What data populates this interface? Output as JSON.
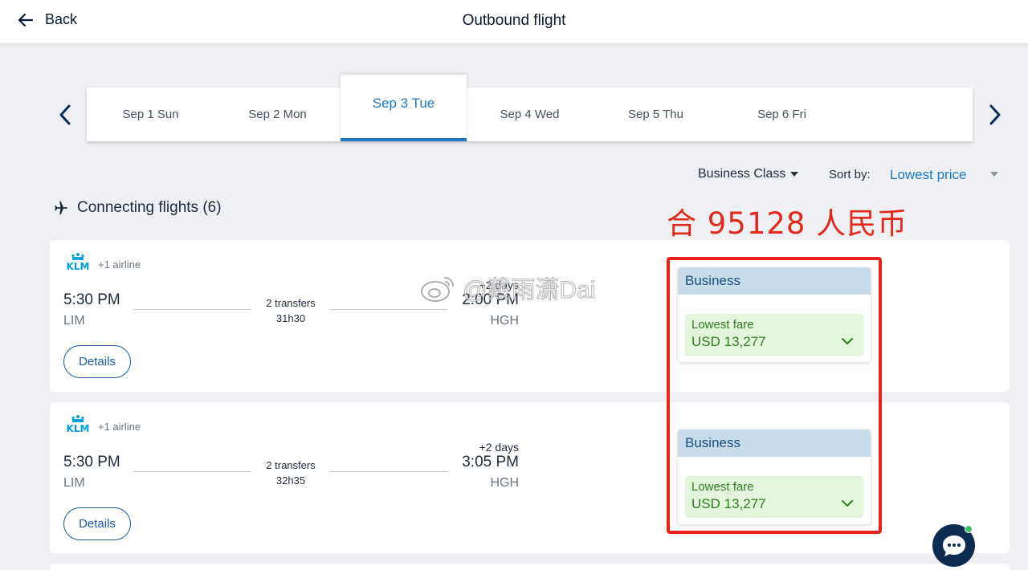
{
  "header": {
    "back_label": "Back",
    "title": "Outbound flight"
  },
  "dates": [
    {
      "label": "Sep 1 Sun",
      "active": false
    },
    {
      "label": "Sep 2 Mon",
      "active": false
    },
    {
      "label": "Sep 3 Tue",
      "active": true
    },
    {
      "label": "Sep 4 Wed",
      "active": false
    },
    {
      "label": "Sep 5 Thu",
      "active": false
    },
    {
      "label": "Sep 6 Fri",
      "active": false
    }
  ],
  "filters": {
    "cabin": "Business Class",
    "sort_label": "Sort by:",
    "sort_value": "Lowest price"
  },
  "section": {
    "title": "Connecting flights (6)"
  },
  "annotation": {
    "text": "合 95128 人民币"
  },
  "watermark": {
    "text": "@戴雨潇Dai"
  },
  "flights": [
    {
      "airline_logo": "KLM",
      "airline_extra": "+1 airline",
      "dep_time": "5:30 PM",
      "dep_code": "LIM",
      "transfers": "2 transfers",
      "duration": "31h30",
      "arr_days": "+2 days",
      "arr_time": "2:00 PM",
      "arr_code": "HGH",
      "details_label": "Details",
      "fare": {
        "cabin": "Business",
        "label": "Lowest fare",
        "price": "USD 13,277"
      }
    },
    {
      "airline_logo": "KLM",
      "airline_extra": "+1 airline",
      "dep_time": "5:30 PM",
      "dep_code": "LIM",
      "transfers": "2 transfers",
      "duration": "32h35",
      "arr_days": "+2 days",
      "arr_time": "3:05 PM",
      "arr_code": "HGH",
      "details_label": "Details",
      "fare": {
        "cabin": "Business",
        "label": "Lowest fare",
        "price": "USD 13,277"
      }
    }
  ],
  "colors": {
    "accent": "#1c7ac4",
    "fare_green": "#2f7d1f",
    "annotation_red": "#e02a1e",
    "chat_navy": "#0d2c52"
  }
}
